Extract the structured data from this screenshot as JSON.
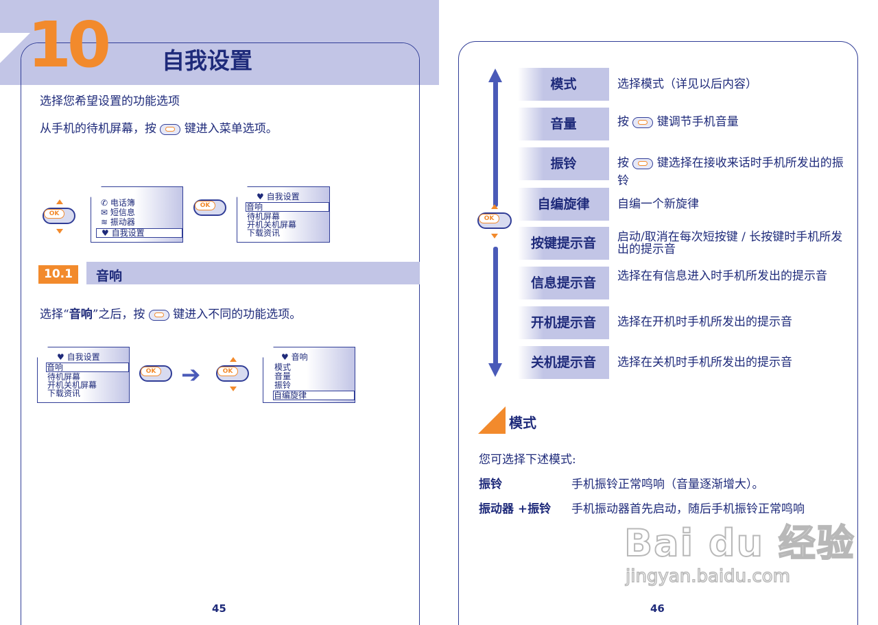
{
  "left_page": {
    "chapter_number": "10",
    "chapter_title": "自我设置",
    "intro_line1": "选择您希望设置的功能选项",
    "intro_line2_before": "从手机的待机屏幕，按",
    "intro_line2_after": "键进入菜单选项。",
    "screen_main_menu": {
      "items": [
        {
          "icon": "phonebook-icon",
          "label": "电话簿"
        },
        {
          "icon": "message-icon",
          "label": "短信息"
        },
        {
          "icon": "vibrator-icon",
          "label": "振动器"
        },
        {
          "icon": "settings-icon",
          "label": "自我设置"
        }
      ]
    },
    "screen_settings_menu": {
      "title": "自我设置",
      "items": [
        "音响",
        "待机屏幕",
        "开机关机屏幕",
        "下载资讯"
      ]
    },
    "section": {
      "number": "10.1",
      "title": "音响"
    },
    "section_text_before": "选择“",
    "section_text_bold": "音响",
    "section_text_after": "”之后，按",
    "section_text_end": "键进入不同的功能选项。",
    "screen_settings_menu_2": {
      "title": "自我设置",
      "items": [
        "音响",
        "待机屏幕",
        "开机关机屏幕",
        "下载资讯"
      ]
    },
    "screen_sound_menu": {
      "title": "音响",
      "items": [
        "模式",
        "音量",
        "振铃",
        "自编旋律"
      ]
    },
    "ok_key_label": "OK",
    "page_number": "45"
  },
  "right_page": {
    "menu_rows": [
      {
        "label": "模式",
        "desc": "选择模式（详见以后内容）"
      },
      {
        "label": "音量",
        "desc_before": "按",
        "desc_after": "键调节手机音量"
      },
      {
        "label": "振铃",
        "desc_before": "按",
        "desc_after": "键选择在接收来话时手机所发出的振铃"
      },
      {
        "label": "自编旋律",
        "desc": "自编一个新旋律"
      },
      {
        "label": "按键提示音",
        "desc": "启动/取消在每次短按键 / 长按键时手机所发出的提示音"
      },
      {
        "label": "信息提示音",
        "desc": "选择在有信息进入时手机所发出的提示音"
      },
      {
        "label": "开机提示音",
        "desc": "选择在开机时手机所发出的提示音"
      },
      {
        "label": "关机提示音",
        "desc": "选择在关机时手机所发出的提示音"
      }
    ],
    "mode_heading": "模式",
    "mode_intro": "您可选择下述模式:",
    "modes": [
      {
        "name": "振铃",
        "desc": "手机振铃正常鸣响（音量逐渐增大）。"
      },
      {
        "name": "振动器 +振铃",
        "desc": "手机振动器首先启动，随后手机振铃正常鸣响"
      }
    ],
    "page_number": "46"
  },
  "watermark": {
    "main": "Bai du 经验",
    "sub": "jingyan.baidu.com"
  },
  "colors": {
    "accent": "#f28a2c",
    "navy": "#1e2a7a",
    "lavender": "#c2c5e6",
    "frame": "#2f3c96"
  }
}
